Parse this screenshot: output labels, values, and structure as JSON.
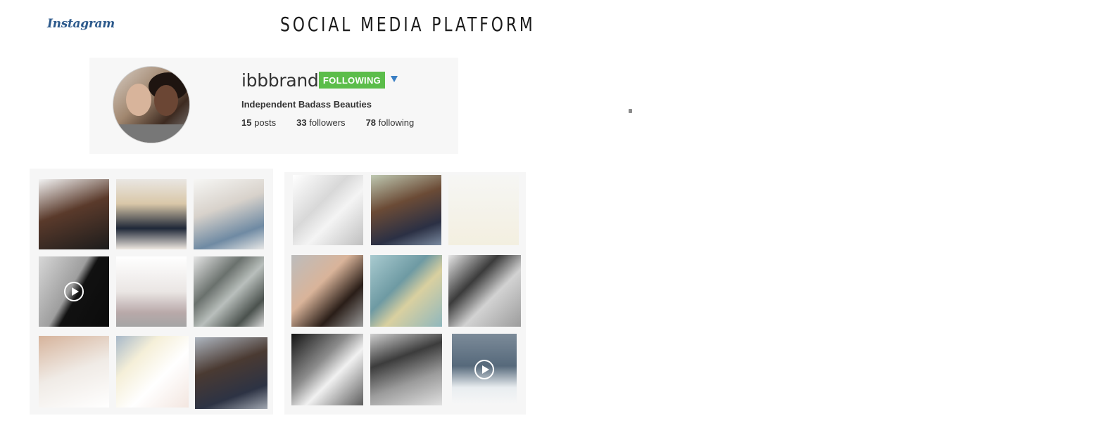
{
  "header": {
    "logo_text": "Instagram",
    "title": "SOCIAL MEDIA PLATFORM"
  },
  "profile": {
    "username": "ibbbrand",
    "follow_button": "FOLLOWING",
    "bio": "Independent Badass Beauties",
    "stats": {
      "posts_count": "15",
      "posts_label": "posts",
      "followers_count": "33",
      "followers_label": "followers",
      "following_count": "78",
      "following_label": "following"
    }
  },
  "grid_left": {
    "tiles": [
      {
        "name": "photo-woman-hand-face",
        "icon": "photo"
      },
      {
        "name": "photo-blonde-woman",
        "icon": "photo"
      },
      {
        "name": "photo-woman-sitting",
        "icon": "photo"
      },
      {
        "name": "video-black-white-shoulder",
        "icon": "play-icon"
      },
      {
        "name": "photo-woman-chair",
        "icon": "photo"
      },
      {
        "name": "photo-agave-plant",
        "icon": "photo"
      },
      {
        "name": "photo-necklace-neck",
        "icon": "photo"
      },
      {
        "name": "photo-sketch-hands",
        "icon": "photo"
      },
      {
        "name": "photo-two-women-hair",
        "icon": "photo"
      }
    ]
  },
  "grid_right": {
    "tiles": [
      {
        "name": "photo-marble-texture",
        "icon": "photo"
      },
      {
        "name": "photo-two-women-hug",
        "icon": "photo"
      },
      {
        "name": "photo-gold-triangle-ring",
        "icon": "photo"
      },
      {
        "name": "photo-ear-hair",
        "icon": "photo"
      },
      {
        "name": "photo-blue-gold-paint",
        "icon": "photo"
      },
      {
        "name": "photo-hands-table",
        "icon": "photo"
      },
      {
        "name": "photo-hand-ring-bw",
        "icon": "photo"
      },
      {
        "name": "photo-women-tree-bw",
        "icon": "photo"
      },
      {
        "name": "video-woman-sitting-blue",
        "icon": "play-icon"
      }
    ]
  },
  "colors": {
    "follow_green": "#5bbd4a",
    "caret_blue": "#3a7fc4",
    "logo_blue": "#2d5a8c"
  }
}
